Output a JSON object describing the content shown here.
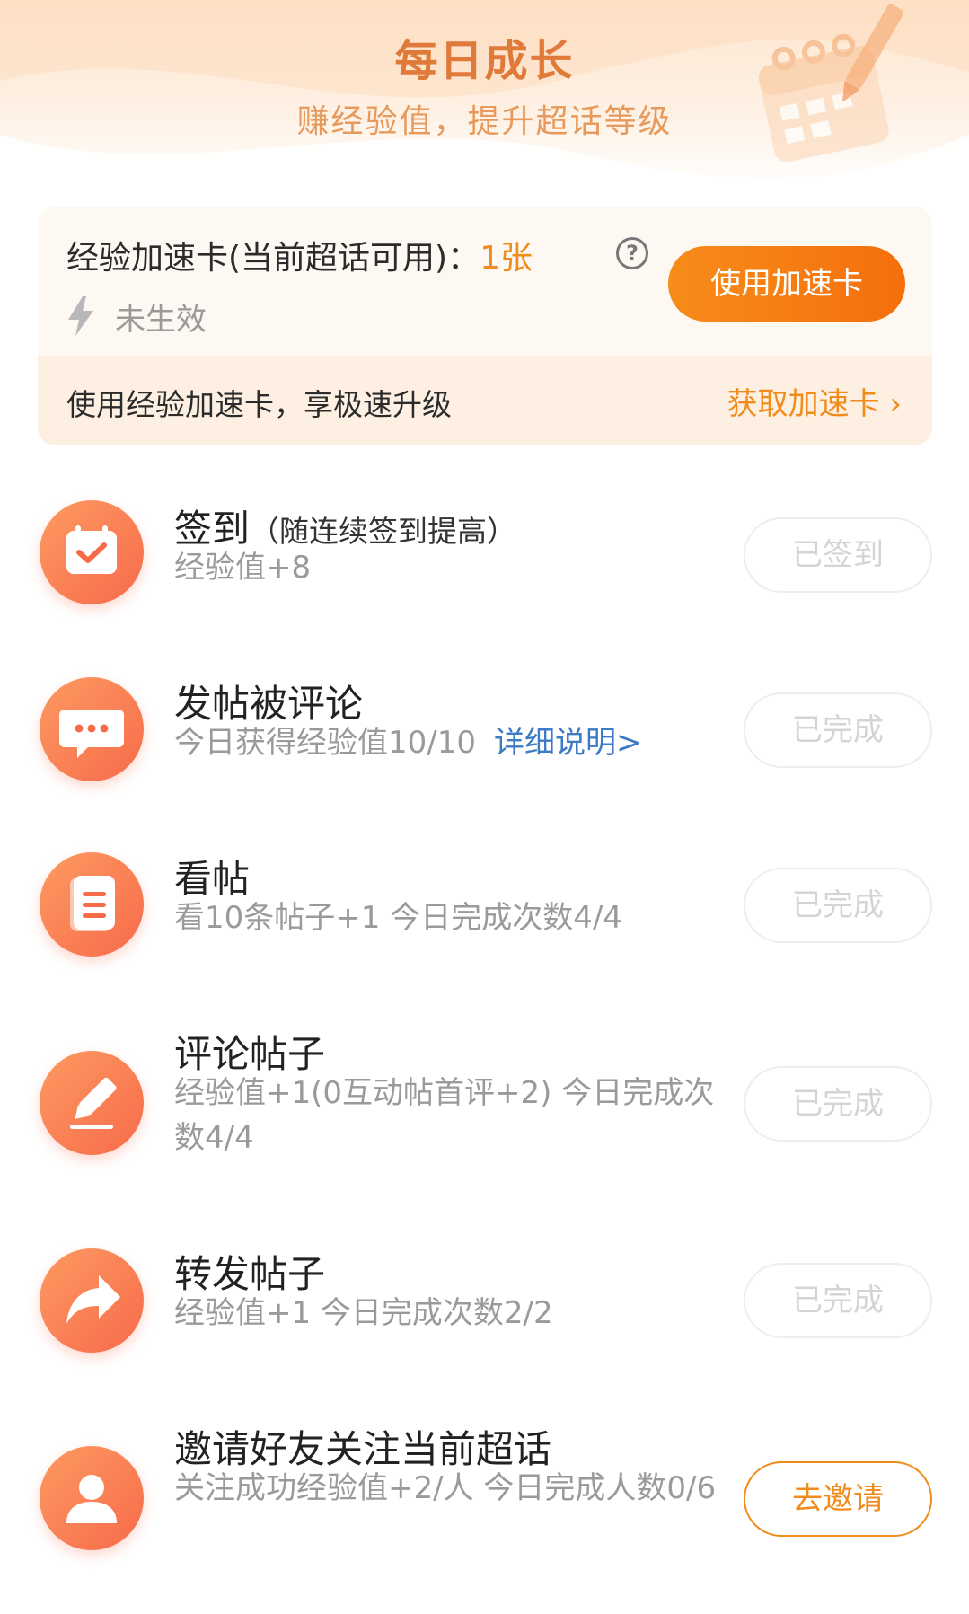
{
  "header": {
    "title": "每日成长",
    "subtitle": "赚经验值，提升超话等级"
  },
  "boost_card": {
    "label": "经验加速卡(当前超话可用)：",
    "count": "1张",
    "status": "未生效",
    "use_button": "使用加速卡",
    "tip": "使用经验加速卡，享极速升级",
    "get_link": "获取加速卡",
    "accent_color": "#f08c1c"
  },
  "tasks": [
    {
      "icon": "calendar-check-icon",
      "title": "签到",
      "title_note": "（随连续签到提高）",
      "desc": "经验值+8",
      "action": "已签到",
      "done": true
    },
    {
      "icon": "chat-bubble-icon",
      "title": "发帖被评论",
      "desc": "今日获得经验值10/10",
      "link": "详细说明>",
      "action": "已完成",
      "done": true
    },
    {
      "icon": "document-icon",
      "title": "看帖",
      "desc": "看10条帖子+1  今日完成次数4/4",
      "action": "已完成",
      "done": true
    },
    {
      "icon": "edit-pen-icon",
      "title": "评论帖子",
      "desc": "经验值+1(0互动帖首评+2)  今日完成次数4/4",
      "action": "已完成",
      "done": true
    },
    {
      "icon": "share-arrow-icon",
      "title": "转发帖子",
      "desc": "经验值+1  今日完成次数2/2",
      "action": "已完成",
      "done": true
    },
    {
      "icon": "user-icon",
      "title": "邀请好友关注当前超话",
      "desc": "关注成功经验值+2/人  今日完成人数0/6",
      "action": "去邀请",
      "done": false
    }
  ]
}
